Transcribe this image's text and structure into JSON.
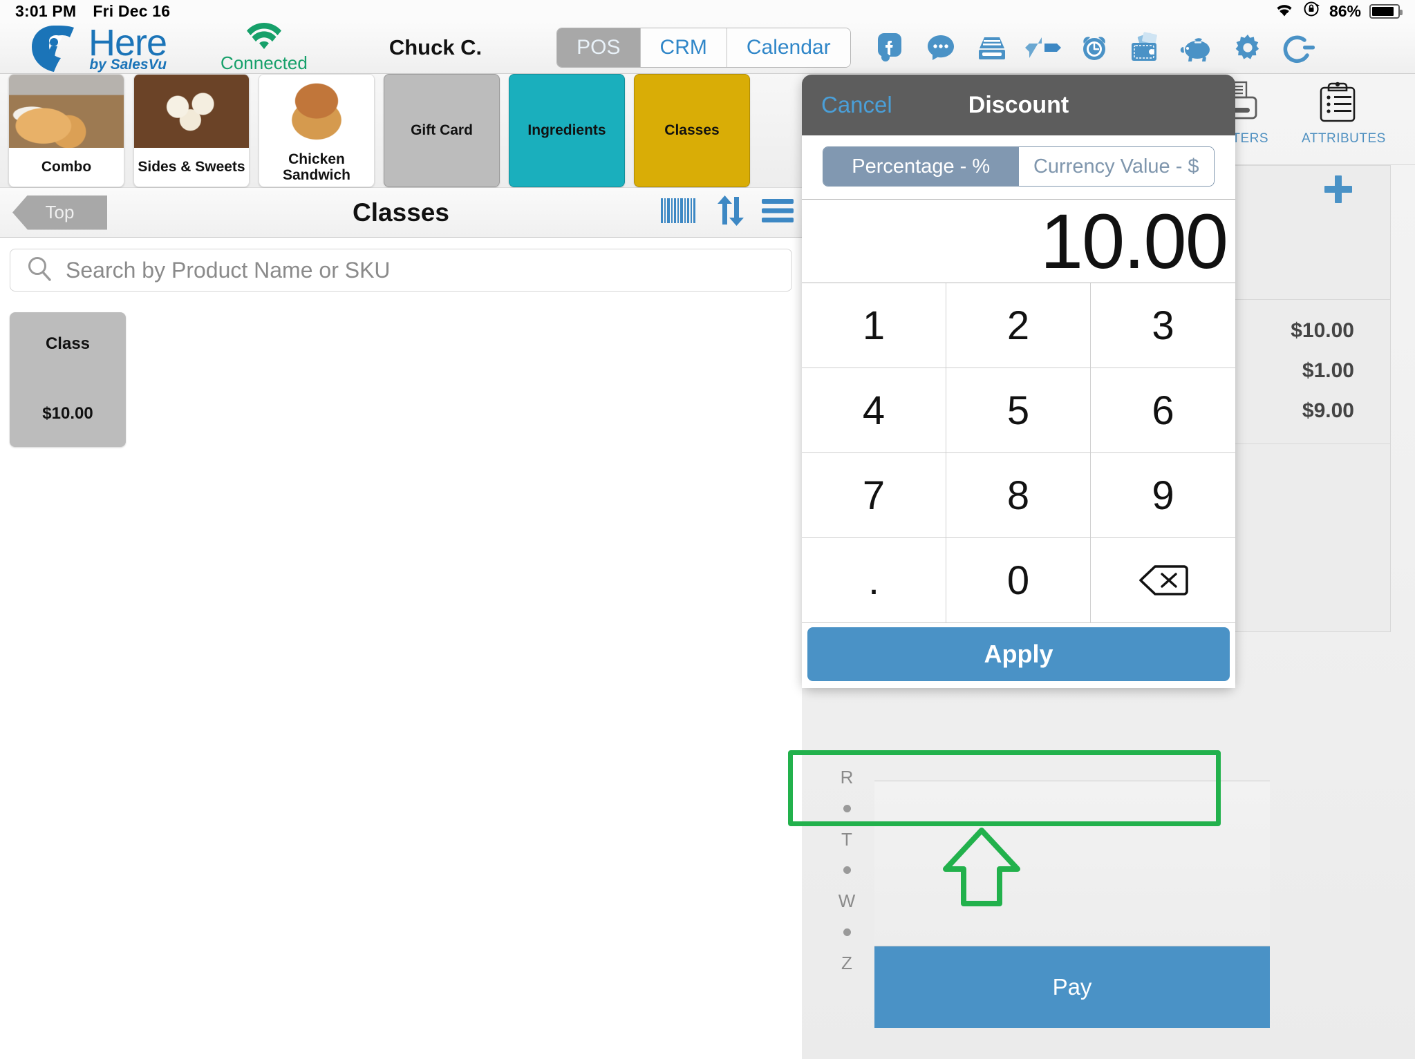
{
  "statusbar": {
    "time": "3:01 PM",
    "date": "Fri Dec 16",
    "battery_pct": "86%",
    "wifi_icon": "wifi-icon",
    "rotation_lock_icon": "rotation-lock-icon",
    "battery_icon": "battery-icon"
  },
  "appbar": {
    "logo_name": "Here",
    "logo_tagline": "by SalesVu",
    "connection_status": "Connected",
    "user": "Chuck C.",
    "tabs": [
      {
        "label": "POS",
        "active": true
      },
      {
        "label": "CRM",
        "active": false
      },
      {
        "label": "Calendar",
        "active": false
      }
    ],
    "icons": [
      "facebook-icon",
      "chat-icon",
      "cash-register-icon",
      "transfer-icon",
      "alarm-clock-icon",
      "wallet-icon",
      "piggy-bank-icon",
      "gear-icon",
      "power-icon"
    ]
  },
  "categories": [
    {
      "label": "Combo",
      "kind": "photo",
      "thumb": "combo"
    },
    {
      "label": "Sides & Sweets",
      "kind": "photo",
      "thumb": "sides"
    },
    {
      "label": "Chicken Sandwich",
      "kind": "photo",
      "thumb": "sandwich"
    },
    {
      "label": "Gift Card",
      "kind": "solid",
      "color": "#bcbcbc"
    },
    {
      "label": "Ingredients",
      "kind": "solid",
      "color": "#1aafbd"
    },
    {
      "label": "Classes",
      "kind": "solid",
      "color": "#d9ad06"
    }
  ],
  "breadcrumb": {
    "back_label": "Top",
    "title": "Classes",
    "icons": [
      "barcode-icon",
      "sort-icon",
      "menu-icon"
    ]
  },
  "search": {
    "placeholder": "Search by Product Name or SKU",
    "value": "",
    "icon": "search-icon"
  },
  "products": [
    {
      "name": "Class",
      "price": "$10.00"
    }
  ],
  "cart": {
    "tools": [
      {
        "label": "PRINTERS",
        "icon": "printer-icon"
      },
      {
        "label": "ATTRIBUTES",
        "icon": "clipboard-icon"
      }
    ],
    "add_icon": "plus-icon",
    "totals": [
      {
        "tag": "%",
        "value": "$10.00"
      },
      {
        "tag": "",
        "value": "$1.00"
      },
      {
        "tag": "",
        "value": "$9.00"
      }
    ],
    "alpha_index": [
      "R",
      "•",
      "T",
      "•",
      "W",
      "•",
      "Z"
    ],
    "pay_label": "Pay"
  },
  "modal": {
    "cancel_label": "Cancel",
    "title": "Discount",
    "modes": [
      {
        "label": "Percentage - %",
        "selected": true
      },
      {
        "label": "Currency Value - $",
        "selected": false
      }
    ],
    "amount": "10.00",
    "keys": [
      "1",
      "2",
      "3",
      "4",
      "5",
      "6",
      "7",
      "8",
      "9",
      ".",
      "0",
      "backspace-icon"
    ],
    "apply_label": "Apply"
  },
  "annotation": {
    "highlight_color": "#22b14c",
    "arrow_icon": "arrow-up-icon"
  }
}
